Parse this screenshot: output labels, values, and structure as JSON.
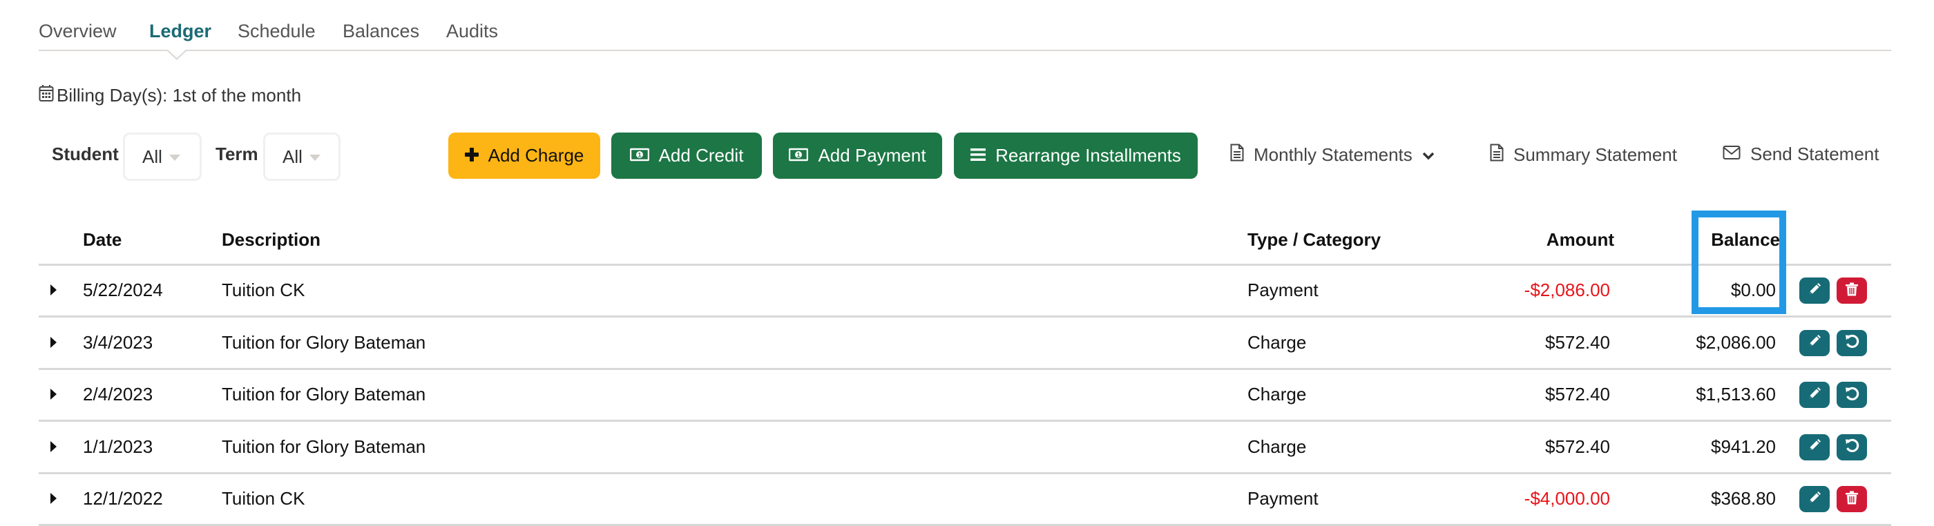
{
  "tabs": [
    {
      "label": "Overview",
      "active": false
    },
    {
      "label": "Ledger",
      "active": true
    },
    {
      "label": "Schedule",
      "active": false
    },
    {
      "label": "Balances",
      "active": false
    },
    {
      "label": "Audits",
      "active": false
    }
  ],
  "billing": {
    "icon": "calendar-icon",
    "text": "Billing Day(s): 1st of the month"
  },
  "filters": {
    "student": {
      "label": "Student",
      "value": "All"
    },
    "term": {
      "label": "Term",
      "value": "All"
    }
  },
  "toolbar": {
    "add_charge": {
      "label": "Add Charge",
      "icon": "plus-icon"
    },
    "add_credit": {
      "label": "Add Credit",
      "icon": "money-bill-icon"
    },
    "add_payment": {
      "label": "Add Payment",
      "icon": "money-bill-icon"
    },
    "rearrange": {
      "label": "Rearrange Installments",
      "icon": "bars-icon"
    },
    "monthly_statements": {
      "label": "Monthly Statements",
      "icon": "document-icon"
    },
    "summary_statement": {
      "label": "Summary Statement",
      "icon": "document-icon"
    },
    "send_statement": {
      "label": "Send Statement",
      "icon": "envelope-icon"
    }
  },
  "colors": {
    "accent_teal": "#1b6a75",
    "charge_yellow": "#fdb515",
    "action_green": "#1c7645",
    "delete_red": "#d11b36",
    "negative_red": "#e8141a",
    "highlight_blue": "#2399e6"
  },
  "table": {
    "headers": {
      "date": "Date",
      "description": "Description",
      "type": "Type / Category",
      "amount": "Amount",
      "balance": "Balance"
    },
    "rows": [
      {
        "date": "5/22/2024",
        "description": "Tuition CK",
        "type": "Payment",
        "amount": "-$2,086.00",
        "negative": true,
        "balance": "$0.00",
        "secondary_action": "delete"
      },
      {
        "date": "3/4/2023",
        "description": "Tuition for Glory Bateman",
        "type": "Charge",
        "amount": "$572.40",
        "negative": false,
        "balance": "$2,086.00",
        "secondary_action": "undo"
      },
      {
        "date": "2/4/2023",
        "description": "Tuition for Glory Bateman",
        "type": "Charge",
        "amount": "$572.40",
        "negative": false,
        "balance": "$1,513.60",
        "secondary_action": "undo"
      },
      {
        "date": "1/1/2023",
        "description": "Tuition for Glory Bateman",
        "type": "Charge",
        "amount": "$572.40",
        "negative": false,
        "balance": "$941.20",
        "secondary_action": "undo"
      },
      {
        "date": "12/1/2022",
        "description": "Tuition CK",
        "type": "Payment",
        "amount": "-$4,000.00",
        "negative": true,
        "balance": "$368.80",
        "secondary_action": "delete"
      }
    ]
  }
}
